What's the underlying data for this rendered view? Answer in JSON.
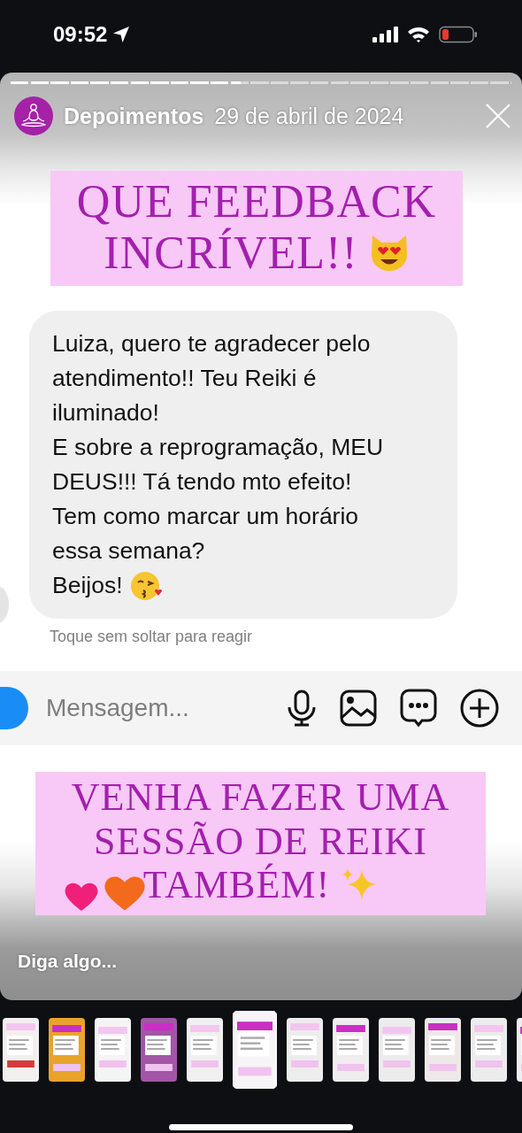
{
  "status_bar": {
    "time": "09:52"
  },
  "story": {
    "progress": {
      "level": 0.46
    },
    "account": "Depoimentos",
    "date": "29 de abril de 2024",
    "title_banner": [
      "QUE FEEDBACK",
      "INCRÍVEL!!"
    ],
    "message": [
      "Luiza, quero te agradecer pelo atendimento!! Teu Reiki é iluminado!",
      "E sobre a reprogramação, MEU DEUS!!! Tá tendo mto efeito!",
      "Tem como marcar um horário essa semana?",
      "Beijos!"
    ],
    "hint": "Toque sem soltar para reagir",
    "composer": {
      "placeholder": "Mensagem..."
    },
    "bottom_banner": [
      "VENHA FAZER UMA",
      "SESSÃO DE REIKI",
      "TAMBÉM!"
    ],
    "reply": {
      "placeholder": "Diga algo..."
    }
  },
  "thumbnails": [
    {
      "kind": "picture",
      "selected": false
    },
    {
      "kind": "picture",
      "selected": false
    },
    {
      "kind": "picture",
      "selected": false
    },
    {
      "kind": "picture",
      "selected": false
    },
    {
      "kind": "picture",
      "selected": false
    },
    {
      "kind": "picture",
      "selected": true
    },
    {
      "kind": "picture",
      "selected": false
    },
    {
      "kind": "picture",
      "selected": false
    },
    {
      "kind": "picture",
      "selected": false
    },
    {
      "kind": "picture",
      "selected": false
    },
    {
      "kind": "picture",
      "selected": false
    },
    {
      "kind": "picture",
      "selected": false
    }
  ]
}
